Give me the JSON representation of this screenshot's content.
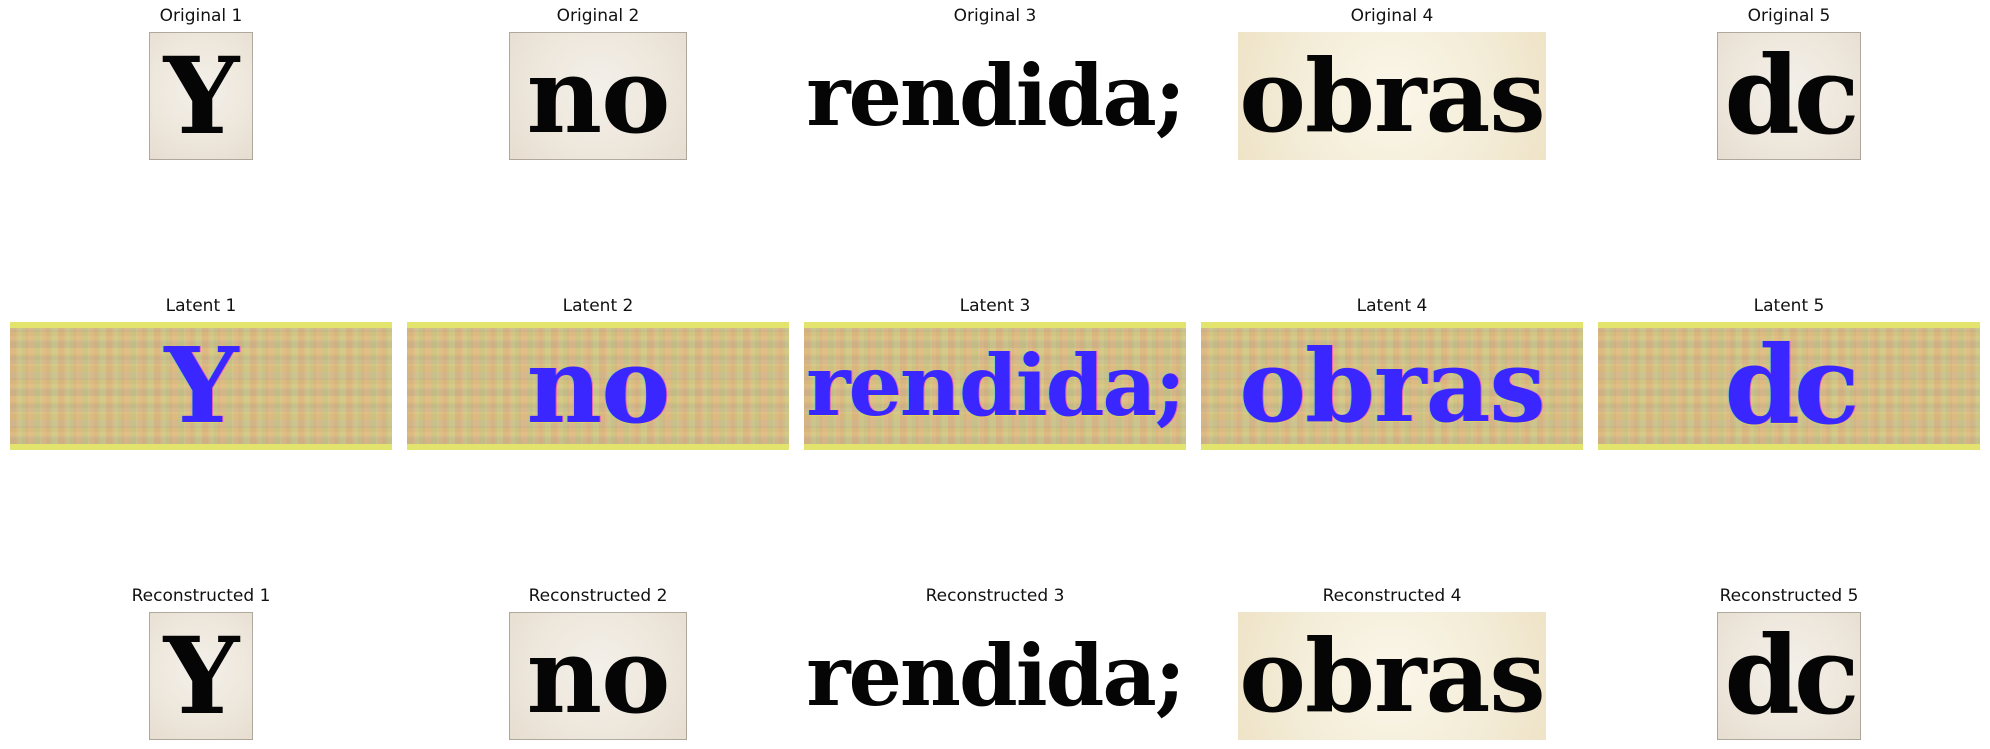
{
  "figure": {
    "rows": [
      {
        "kind": "original",
        "titles": [
          "Original 1",
          "Original 2",
          "Original 3",
          "Original 4",
          "Original 5"
        ],
        "words": [
          "Y",
          "no",
          "rendida;",
          "obras",
          "dc"
        ]
      },
      {
        "kind": "latent",
        "titles": [
          "Latent 1",
          "Latent 2",
          "Latent 3",
          "Latent 4",
          "Latent 5"
        ],
        "words": [
          "Y",
          "no",
          "rendida;",
          "obras",
          "dc"
        ]
      },
      {
        "kind": "reconstructed",
        "titles": [
          "Reconstructed 1",
          "Reconstructed 2",
          "Reconstructed 3",
          "Reconstructed 4",
          "Reconstructed 5"
        ],
        "words": [
          "Y",
          "no",
          "rendida;",
          "obras",
          "dc"
        ]
      }
    ]
  }
}
